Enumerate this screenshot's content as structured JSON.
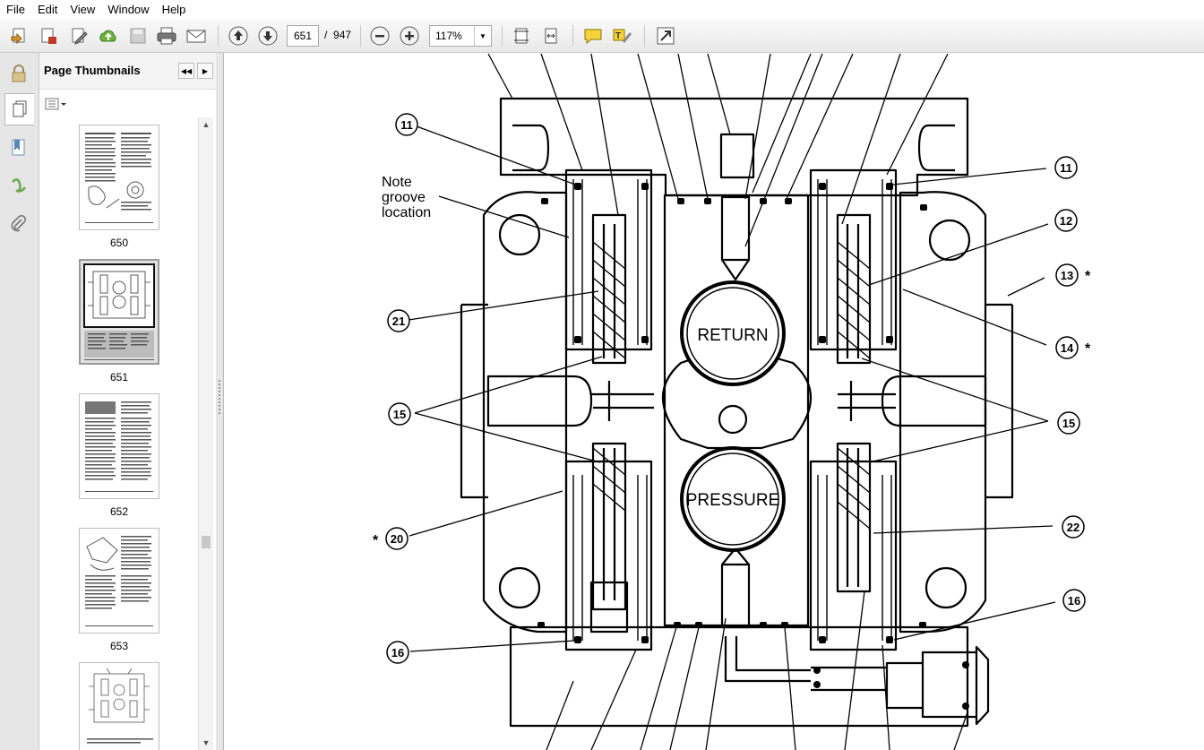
{
  "menu": [
    "File",
    "Edit",
    "View",
    "Window",
    "Help"
  ],
  "toolbar": {
    "page_current": "651",
    "page_separator": "/",
    "page_total": "947",
    "zoom": "117%",
    "icons": [
      "create-pdf-icon",
      "save-as-icon",
      "edit-icon",
      "upload-cloud-icon",
      "save-icon",
      "print-icon",
      "email-icon",
      "previous-page-icon",
      "next-page-icon",
      "zoom-out-icon",
      "zoom-in-icon",
      "fit-page-icon",
      "fit-width-icon",
      "comment-icon",
      "highlight-text-icon",
      "expand-icon"
    ]
  },
  "left_rail": {
    "icons": [
      "lock-icon",
      "pages-icon",
      "bookmark-icon",
      "signature-icon",
      "attachment-icon"
    ]
  },
  "panel": {
    "title": "Page Thumbnails",
    "thumbnails": [
      {
        "page": "650",
        "selected": false
      },
      {
        "page": "651",
        "selected": true
      },
      {
        "page": "652",
        "selected": false
      },
      {
        "page": "653",
        "selected": false
      },
      {
        "page": "",
        "selected": false
      }
    ]
  },
  "diagram": {
    "note": [
      "Note",
      "groove",
      "location"
    ],
    "return_label": "RETURN",
    "pressure_label": "PRESSURE",
    "callouts": {
      "c11_left": "11",
      "c11_right": "11",
      "c12": "12",
      "c13": "13",
      "c14": "14",
      "c15_left": "15",
      "c15_right": "15",
      "c16_left": "16",
      "c16_right": "16",
      "c20": "20",
      "c21": "21",
      "c22": "22"
    },
    "asterisk": "*"
  }
}
